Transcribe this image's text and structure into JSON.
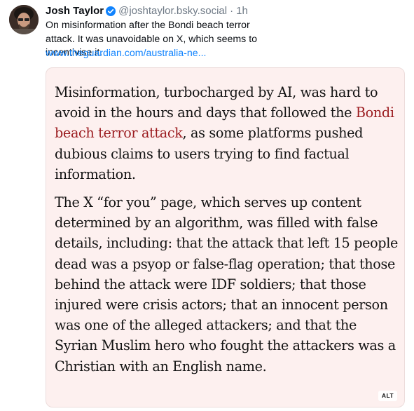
{
  "author": {
    "display_name": "Josh Taylor",
    "handle": "@joshtaylor.bsky.social",
    "separator": "·",
    "time": "1h",
    "avatar_icon": "profile-photo",
    "verified_icon": "verified-badge-icon",
    "verified_color": "#1083fe"
  },
  "post": {
    "text": "On misinformation after the Bondi beach terror attack. It was unavoidable on X, which seems to incentivise it.",
    "link": "www.theguardian.com/australia-ne..."
  },
  "image": {
    "alt_badge": "ALT",
    "background": "#fdf0ef",
    "paragraph1": {
      "before": "Misinformation, turbocharged by AI, was hard to avoid in the hours and days that followed the ",
      "link": "Bondi beach terror attack",
      "after": ", as some platforms pushed dubious claims to users trying to find factual information."
    },
    "paragraph2": "The X “for you” page, which serves up content determined by an algorithm, was filled with false details, including: that the attack that left 15 people dead was a psyop or false-flag operation; that those behind the attack were IDF soldiers; that those injured were crisis actors; that an innocent person was one of the alleged attackers; and that the Syrian Muslim hero who fought the attackers was a Christian with an English name.",
    "link_color": "#9b1b1f"
  }
}
